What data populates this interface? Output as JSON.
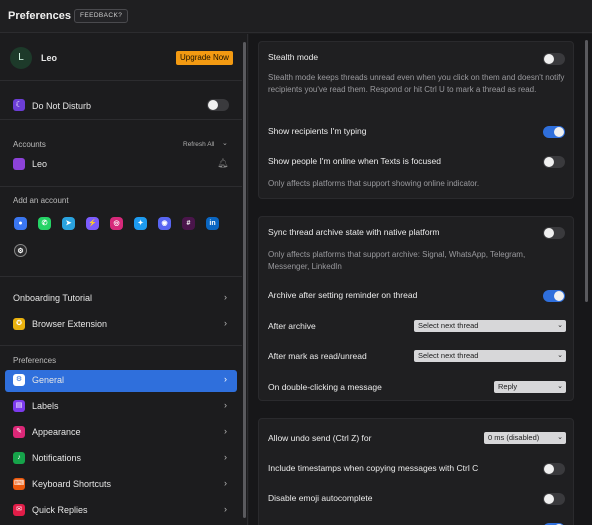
{
  "window": {
    "title": "Preferences",
    "feedback_label": "FEEDBACK?"
  },
  "profile": {
    "avatar_initial": "L",
    "name": "Leo",
    "upgrade_label": "Upgrade Now"
  },
  "dnd": {
    "label": "Do Not Disturb",
    "enabled": false
  },
  "accounts": {
    "header": "Accounts",
    "refresh_label": "Refresh All",
    "items": [
      {
        "name": "Leo",
        "icon": "beeper-icon"
      }
    ]
  },
  "add_account": {
    "header": "Add an account",
    "networks": [
      {
        "name": "signal",
        "icon": "signal-icon",
        "color": "#3a76f0",
        "glyph": "●"
      },
      {
        "name": "whatsapp",
        "icon": "whatsapp-icon",
        "color": "#25d366",
        "glyph": "✆"
      },
      {
        "name": "telegram",
        "icon": "telegram-icon",
        "color": "#2aa3df",
        "glyph": "➤"
      },
      {
        "name": "messenger",
        "icon": "messenger-icon",
        "color": "#7b5cff",
        "glyph": "⚡"
      },
      {
        "name": "instagram",
        "icon": "instagram-icon",
        "color": "#d6297a",
        "glyph": "◎"
      },
      {
        "name": "twitter",
        "icon": "twitter-icon",
        "color": "#1d9bf0",
        "glyph": "✦"
      },
      {
        "name": "discord",
        "icon": "discord-icon",
        "color": "#5865f2",
        "glyph": "◉"
      },
      {
        "name": "slack",
        "icon": "slack-icon",
        "color": "#4a154b",
        "glyph": "#"
      },
      {
        "name": "linkedin",
        "icon": "linkedin-icon",
        "color": "#0a66c2",
        "glyph": "in"
      },
      {
        "name": "chatgpt",
        "icon": "chatgpt-icon",
        "color": "#2a2a2c",
        "glyph": "⚙"
      }
    ]
  },
  "nav_top": [
    {
      "label": "Onboarding Tutorial",
      "icon": ""
    },
    {
      "label": "Browser Extension",
      "icon": "extension-icon"
    }
  ],
  "preferences_header": "Preferences",
  "nav": [
    {
      "label": "General",
      "icon": "gear-icon",
      "color": "#ffffff",
      "glyph": "⚙",
      "active": true
    },
    {
      "label": "Labels",
      "icon": "labels-icon",
      "color": "#7c3aed",
      "glyph": "▤",
      "active": false
    },
    {
      "label": "Appearance",
      "icon": "appearance-icon",
      "color": "#db2777",
      "glyph": "✎",
      "active": false
    },
    {
      "label": "Notifications",
      "icon": "bell-icon",
      "color": "#16a34a",
      "glyph": "♪",
      "active": false
    },
    {
      "label": "Keyboard Shortcuts",
      "icon": "keyboard-icon",
      "color": "#ea580c",
      "glyph": "⌨",
      "active": false
    },
    {
      "label": "Quick Replies",
      "icon": "quick-replies-icon",
      "color": "#e11d48",
      "glyph": "✉",
      "active": false
    }
  ],
  "settings": {
    "stealth": {
      "title": "Stealth mode",
      "desc": "Stealth mode keeps threads unread even when you click on them and doesn't notify recipients you've read them. Respond or hit Ctrl U to mark a thread as read.",
      "enabled": false
    },
    "typing": {
      "title": "Show recipients I'm typing",
      "enabled": true
    },
    "online": {
      "title": "Show people I'm online when Texts is focused",
      "desc": "Only affects platforms that support showing online indicator.",
      "enabled": false
    },
    "sync_archive": {
      "title": "Sync thread archive state with native platform",
      "desc": "Only affects platforms that support archive: Signal, WhatsApp, Telegram, Messenger, LinkedIn",
      "enabled": false
    },
    "archive_reminder": {
      "title": "Archive after setting reminder on thread",
      "enabled": true
    },
    "after_archive": {
      "title": "After archive",
      "value": "Select next thread"
    },
    "after_mark_read": {
      "title": "After mark as read/unread",
      "value": "Select next thread"
    },
    "double_click": {
      "title": "On double-clicking a message",
      "value": "Reply"
    },
    "undo_send": {
      "title": "Allow undo send (Ctrl Z) for",
      "value": "0 ms (disabled)"
    },
    "timestamps": {
      "title": "Include timestamps when copying messages with Ctrl C",
      "enabled": false
    },
    "emoji": {
      "title": "Disable emoji autocomplete",
      "enabled": false
    },
    "partial_next": {
      "enabled": true
    }
  }
}
